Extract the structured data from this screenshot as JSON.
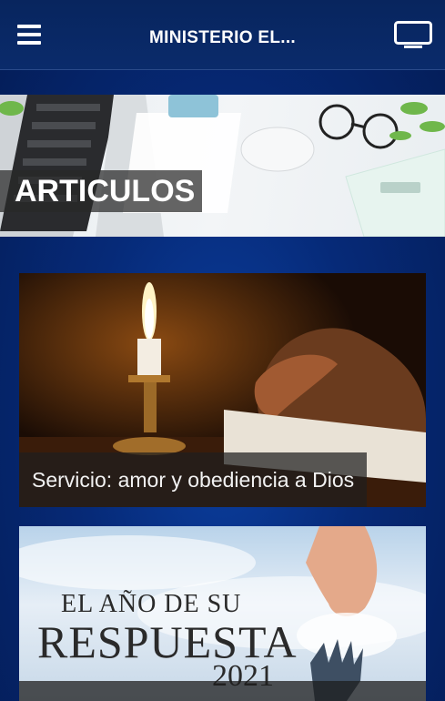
{
  "header": {
    "title": "MINISTERIO EL..."
  },
  "banner": {
    "label": "ARTICULOS"
  },
  "cards": [
    {
      "caption": "Servicio: amor y obediencia a Dios"
    },
    {
      "image_text": {
        "line1": "EL AÑO DE SU",
        "line2": "RESPUESTA",
        "line3": "2021"
      }
    }
  ],
  "colors": {
    "header_bg": "#0a2b6b",
    "page_bg": "#062a78"
  }
}
